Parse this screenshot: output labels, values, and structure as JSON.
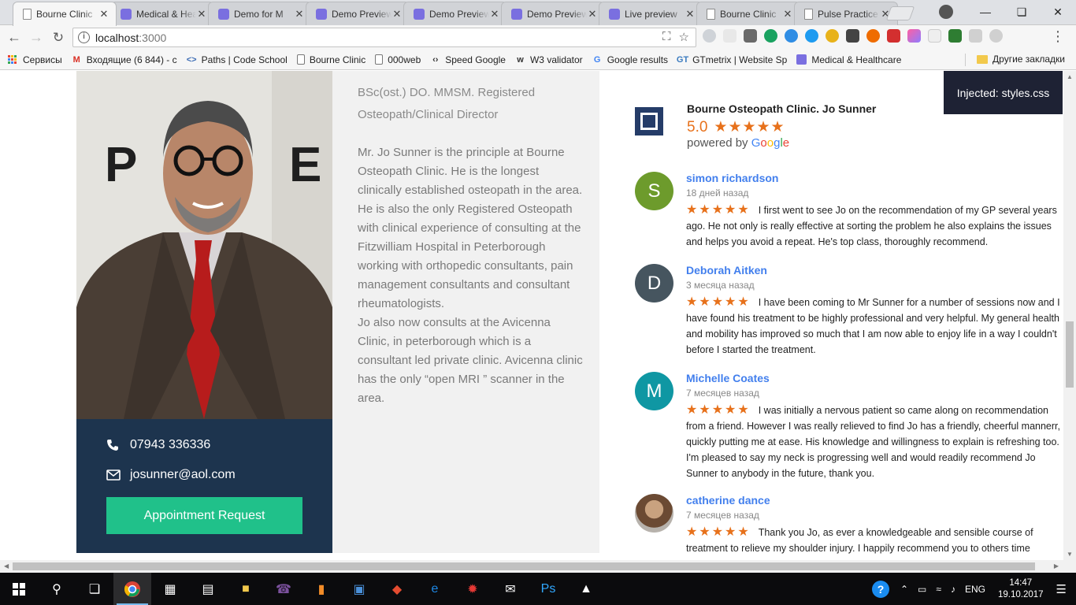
{
  "browser": {
    "tabs": [
      {
        "title": "Bourne Clinic",
        "favicon": "doc",
        "active": true
      },
      {
        "title": "Medical & Health",
        "favicon": "purple",
        "active": false
      },
      {
        "title": "Demo for M",
        "favicon": "purple",
        "active": false
      },
      {
        "title": "Demo Preview",
        "favicon": "purple",
        "active": false
      },
      {
        "title": "Demo Preview",
        "favicon": "purple",
        "active": false
      },
      {
        "title": "Demo Preview",
        "favicon": "purple",
        "active": false
      },
      {
        "title": "Live preview",
        "favicon": "purple",
        "active": false
      },
      {
        "title": "Bourne Clinic",
        "favicon": "doc",
        "active": false
      },
      {
        "title": "Pulse Practice",
        "favicon": "doc",
        "active": false
      }
    ],
    "address": {
      "host": "localhost",
      "port": ":3000"
    },
    "bookmarks": [
      {
        "label": "Сервисы",
        "icon": "apps-grid-icon"
      },
      {
        "label": "Входящие (6 844) - c",
        "icon": "gmail-icon",
        "icon_color": "#d93025",
        "glyph": "M"
      },
      {
        "label": "Paths | Code School",
        "icon": "code-school-icon",
        "icon_color": "#3d6db5",
        "glyph": "<>"
      },
      {
        "label": "Bourne Clinic",
        "icon": "doc-icon"
      },
      {
        "label": "000web",
        "icon": "doc-icon"
      },
      {
        "label": "Speed Google",
        "icon": "speed-icon",
        "glyph": "‹›"
      },
      {
        "label": "W3 validator",
        "icon": "w3-icon",
        "glyph": "w"
      },
      {
        "label": "Google results",
        "icon": "google-icon",
        "icon_color": "#4285f4",
        "glyph": "G"
      },
      {
        "label": "GTmetrix | Website Sp",
        "icon": "gtmetrix-icon",
        "icon_color": "#3a7bbf",
        "glyph": "GT"
      },
      {
        "label": "Medical & Healthcare",
        "icon": "themeforest-icon",
        "icon_color": "#7a6fe0",
        "glyph": ""
      }
    ],
    "other_bookmarks": "Другие закладки"
  },
  "page": {
    "bio": {
      "credentials": "BSc(ost.) DO. MMSM. Registered Osteopath/Clinical Director",
      "paragraph1": "Mr. Jo Sunner is the principle at Bourne Osteopath Clinic. He is the longest clinically established osteopath in the area. He is also the only Registered Osteopath with clinical experience of consulting at the Fitzwilliam Hospital in Peterborough working with orthopedic consultants, pain management consultants and consultant rheumatologists.",
      "paragraph2": "Jo also now consults at the Avicenna Clinic, in peterborough which is a consultant led private clinic. Avicenna clinic has the only “open MRI ” scanner in the area."
    },
    "contact": {
      "phone": "07943 336336",
      "email": "josunner@aol.com",
      "appointment_button": "Appointment Request"
    },
    "google_reviews": {
      "business_name": "Bourne Osteopath Clinic. Jo Sunner",
      "rating": "5.0",
      "stars": 5,
      "powered_by": "powered by",
      "google_word": "Google",
      "reviews": [
        {
          "name": "simon richardson",
          "date": "18 дней назад",
          "initial": "S",
          "avatar_color": "#6d9b2c",
          "stars": 5,
          "text": "I first went to see Jo on the recommendation of my GP several years ago. He not only is really effective at sorting the problem he also explains the issues and helps you avoid a repeat. He's top class, thoroughly recommend."
        },
        {
          "name": "Deborah Aitken",
          "date": "3 месяца назад",
          "initial": "D",
          "avatar_color": "#46555f",
          "stars": 5,
          "text": "I have been coming to Mr Sunner for a number of sessions now and I have found his treatment to be highly professional and very helpful. My general health and mobility has improved so much that I am now able to enjoy life in a way I couldn't before I started the treatment."
        },
        {
          "name": "Michelle Coates",
          "date": "7 месяцев назад",
          "initial": "M",
          "avatar_color": "#0f97a3",
          "stars": 5,
          "text": "I was initially a nervous patient so came along on recommendation from a friend. However I was really relieved to find Jo has a friendly, cheerful mannerr, quickly putting me at ease. His knowledge and willingness to explain is refreshing too. I'm pleased to say my neck is progressing well and would readily recommend Jo Sunner to anybody in the future, thank you."
        },
        {
          "name": "catherine dance",
          "date": "7 месяцев назад",
          "initial": "",
          "avatar_color": "#8a7058",
          "stars": 5,
          "text": "Thank you Jo, as ever a knowledgeable and sensible course of treatment to relieve my shoulder injury. I happily recommend you to others time"
        }
      ]
    },
    "injected_notice": "Injected: styles.css"
  },
  "taskbar": {
    "language": "ENG",
    "time": "14:47",
    "date": "19.10.2017"
  }
}
